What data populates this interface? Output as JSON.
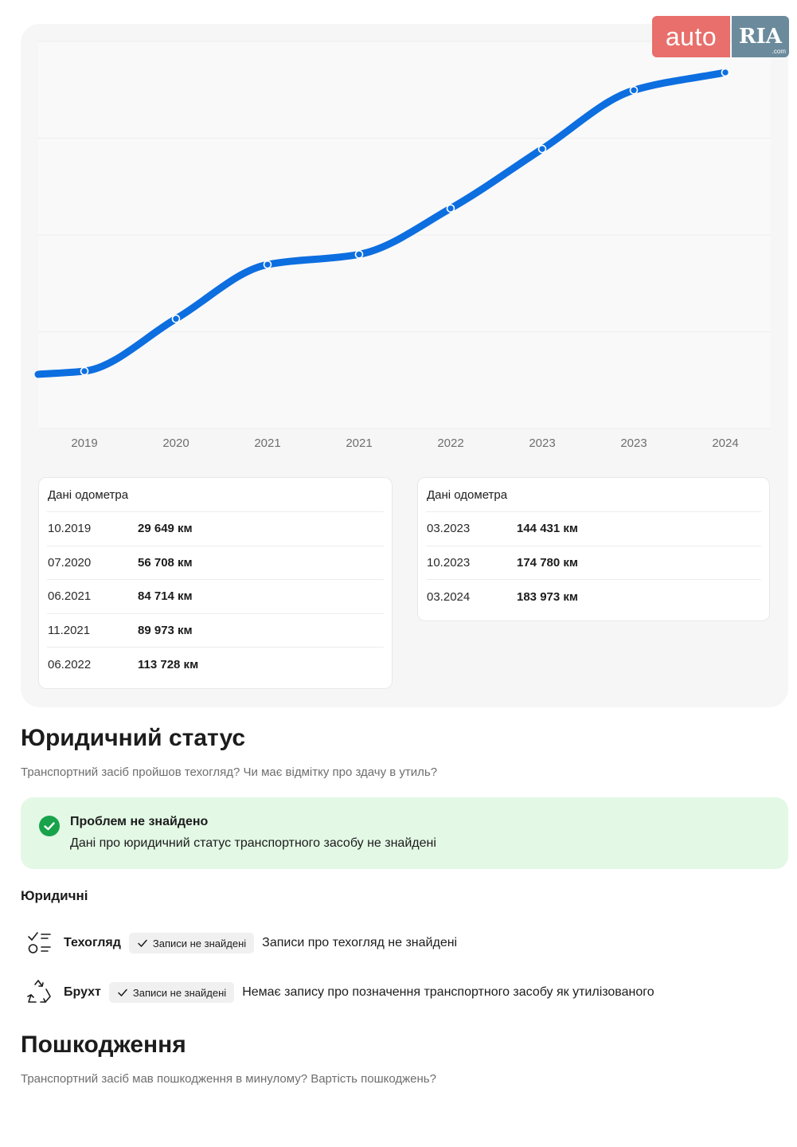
{
  "logo": {
    "left": "auto",
    "right": "RIA",
    "suffix": ".com"
  },
  "odometer": {
    "chart_data": {
      "type": "line",
      "categories": [
        "10.2019",
        "07.2020",
        "06.2021",
        "11.2021",
        "06.2022",
        "03.2023",
        "10.2023",
        "03.2024"
      ],
      "tick_labels": [
        "2019",
        "2020",
        "2021",
        "2021",
        "2022",
        "2023",
        "2023",
        "2024"
      ],
      "values": [
        29649,
        56708,
        84714,
        89973,
        113728,
        144431,
        174780,
        183973
      ],
      "ylim": [
        0,
        200000
      ],
      "grid": true,
      "color": "#0d6ee0"
    },
    "cards": [
      {
        "title": "Дані одометра",
        "rows": [
          {
            "date": "10.2019",
            "km": "29 649 км"
          },
          {
            "date": "07.2020",
            "km": "56 708 км"
          },
          {
            "date": "06.2021",
            "km": "84 714 км"
          },
          {
            "date": "11.2021",
            "km": "89 973 км"
          },
          {
            "date": "06.2022",
            "km": "113 728 км"
          }
        ]
      },
      {
        "title": "Дані одометра",
        "rows": [
          {
            "date": "03.2023",
            "km": "144 431 км"
          },
          {
            "date": "10.2023",
            "km": "174 780 км"
          },
          {
            "date": "03.2024",
            "km": "183 973 км"
          }
        ]
      }
    ]
  },
  "legal": {
    "title": "Юридичний статус",
    "subtitle": "Транспортний засіб пройшов техогляд? Чи має відмітку про здачу в утиль?",
    "banner": {
      "title": "Проблем не знайдено",
      "text": "Дані про юридичний статус транспортного засобу не знайдені",
      "color": "#18a34a"
    },
    "group_title": "Юридичні",
    "checks": [
      {
        "icon": "checklist-icon",
        "label": "Техогляд",
        "chip": "Записи не знайдені",
        "desc": "Записи про техогляд не знайдені"
      },
      {
        "icon": "recycle-icon",
        "label": "Брухт",
        "chip": "Записи не знайдені",
        "desc": "Немає запису про позначення транспортного засобу як утилізованого"
      }
    ]
  },
  "damage": {
    "title": "Пошкодження",
    "subtitle": "Транспортний засіб мав пошкодження в минулому? Вартість пошкоджень?"
  }
}
